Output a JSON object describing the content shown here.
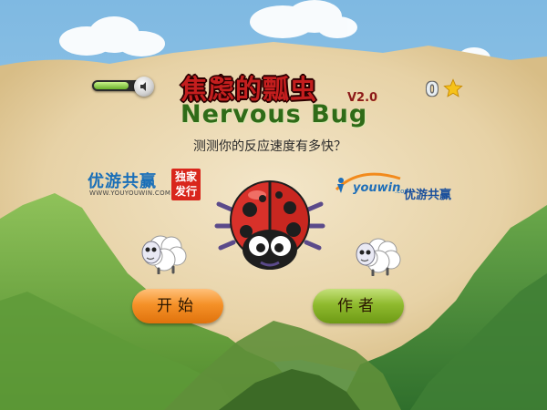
{
  "title": {
    "chinese": "焦虑的瓢虫",
    "version": "V2.0",
    "english": "Nervous Bug"
  },
  "subtitle": "测测你的反应速度有多快？",
  "score": {
    "value": "0",
    "icon": "star-icon"
  },
  "volume": {
    "level_percent": 70,
    "icon": "speaker-knob-icon"
  },
  "logos": {
    "left": {
      "name": "优游共赢",
      "url": "WWW.YOUYOUWIN.COM",
      "badge_line1": "独家",
      "badge_line2": "发行"
    },
    "right": {
      "brand": "youwin",
      "dot": ".com",
      "name": "优游共赢"
    }
  },
  "buttons": {
    "start": "开始",
    "author": "作者"
  },
  "colors": {
    "start_button": "#f59128",
    "author_button": "#8fba2e",
    "title_red": "#c41e1e",
    "title_green": "#2f6b18",
    "sky": "#8fc4e8",
    "hills": "#6fa840"
  }
}
